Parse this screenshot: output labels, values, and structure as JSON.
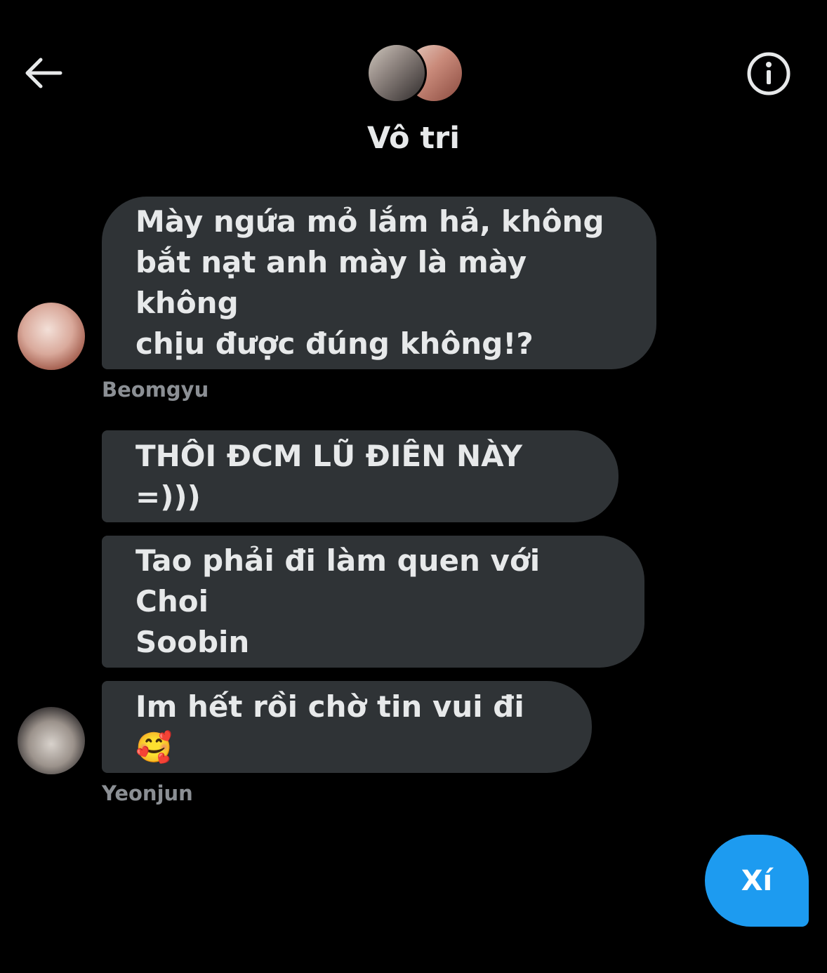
{
  "header": {
    "back_icon": "arrow-left-icon",
    "info_icon": "info-circle-icon",
    "title": "Vô tri"
  },
  "messages": [
    {
      "lines": [
        "Mày ngứa mỏ lắm hả, không",
        "bắt nạt anh mày là mày không",
        "chịu được đúng không!?"
      ],
      "sender": "Beomgyu"
    },
    {
      "lines": [
        "THÔI ĐCM LŨ ĐIÊN NÀY =)))"
      ]
    },
    {
      "lines": [
        "Tao phải đi làm quen với Choi",
        "Soobin"
      ]
    },
    {
      "lines": [
        "Im hết rồi chờ tin vui đi 🥰"
      ],
      "sender": "Yeonjun"
    }
  ],
  "reply": {
    "label": "Xí"
  },
  "colors": {
    "background": "#000000",
    "bubble": "#2f3336",
    "text": "#e7e9ea",
    "sender": "#8b8f94",
    "accent": "#1d9bf0"
  }
}
